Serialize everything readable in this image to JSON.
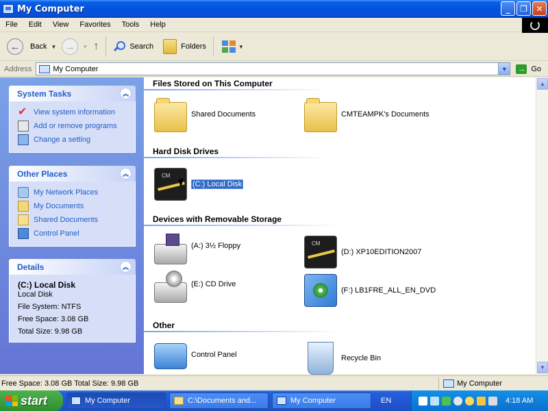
{
  "window": {
    "title": "My Computer"
  },
  "menubar": {
    "items": [
      "File",
      "Edit",
      "View",
      "Favorites",
      "Tools",
      "Help"
    ]
  },
  "toolbar": {
    "back_label": "Back",
    "search_label": "Search",
    "folders_label": "Folders"
  },
  "addressbar": {
    "label": "Address",
    "value": "My Computer",
    "go_label": "Go"
  },
  "sidebar": {
    "system_tasks": {
      "title": "System Tasks",
      "items": [
        {
          "label": "View system information",
          "icon": "check-icon"
        },
        {
          "label": "Add or remove programs",
          "icon": "programs-icon"
        },
        {
          "label": "Change a setting",
          "icon": "control-panel-icon"
        }
      ]
    },
    "other_places": {
      "title": "Other Places",
      "items": [
        {
          "label": "My Network Places",
          "icon": "network-icon"
        },
        {
          "label": "My Documents",
          "icon": "documents-icon"
        },
        {
          "label": "Shared Documents",
          "icon": "folder-icon"
        },
        {
          "label": "Control Panel",
          "icon": "control-panel-icon"
        }
      ]
    },
    "details": {
      "title": "Details",
      "name": "(C:) Local Disk",
      "type": "Local Disk",
      "file_system": "File System: NTFS",
      "free_space": "Free Space: 3.08 GB",
      "total_size": "Total Size: 9.98 GB"
    }
  },
  "content": {
    "groups": {
      "files": {
        "title": "Files Stored on This Computer",
        "items": [
          "Shared Documents",
          "CMTEAMPK's Documents"
        ]
      },
      "hard_disks": {
        "title": "Hard Disk Drives",
        "items": [
          "(C:) Local Disk"
        ]
      },
      "removable": {
        "title": "Devices with Removable Storage",
        "items": [
          "(A:) 3½ Floppy",
          "(D:) XP10EDITION2007",
          "(E:) CD Drive",
          "(F:) LB1FRE_ALL_EN_DVD"
        ]
      },
      "other": {
        "title": "Other",
        "items": [
          "Control Panel",
          "Recycle Bin"
        ]
      }
    }
  },
  "statusbar": {
    "text": "Free Space: 3.08 GB Total Size: 9.98 GB",
    "location": "My Computer"
  },
  "taskbar": {
    "start_label": "start",
    "tasks": [
      "My Computer",
      "C:\\Documents and...",
      "My Computer"
    ],
    "language": "EN",
    "clock": "4:18 AM"
  },
  "colors": {
    "selection": "#316ac5",
    "link": "#215dc6",
    "titlebar": "#0053e1"
  }
}
